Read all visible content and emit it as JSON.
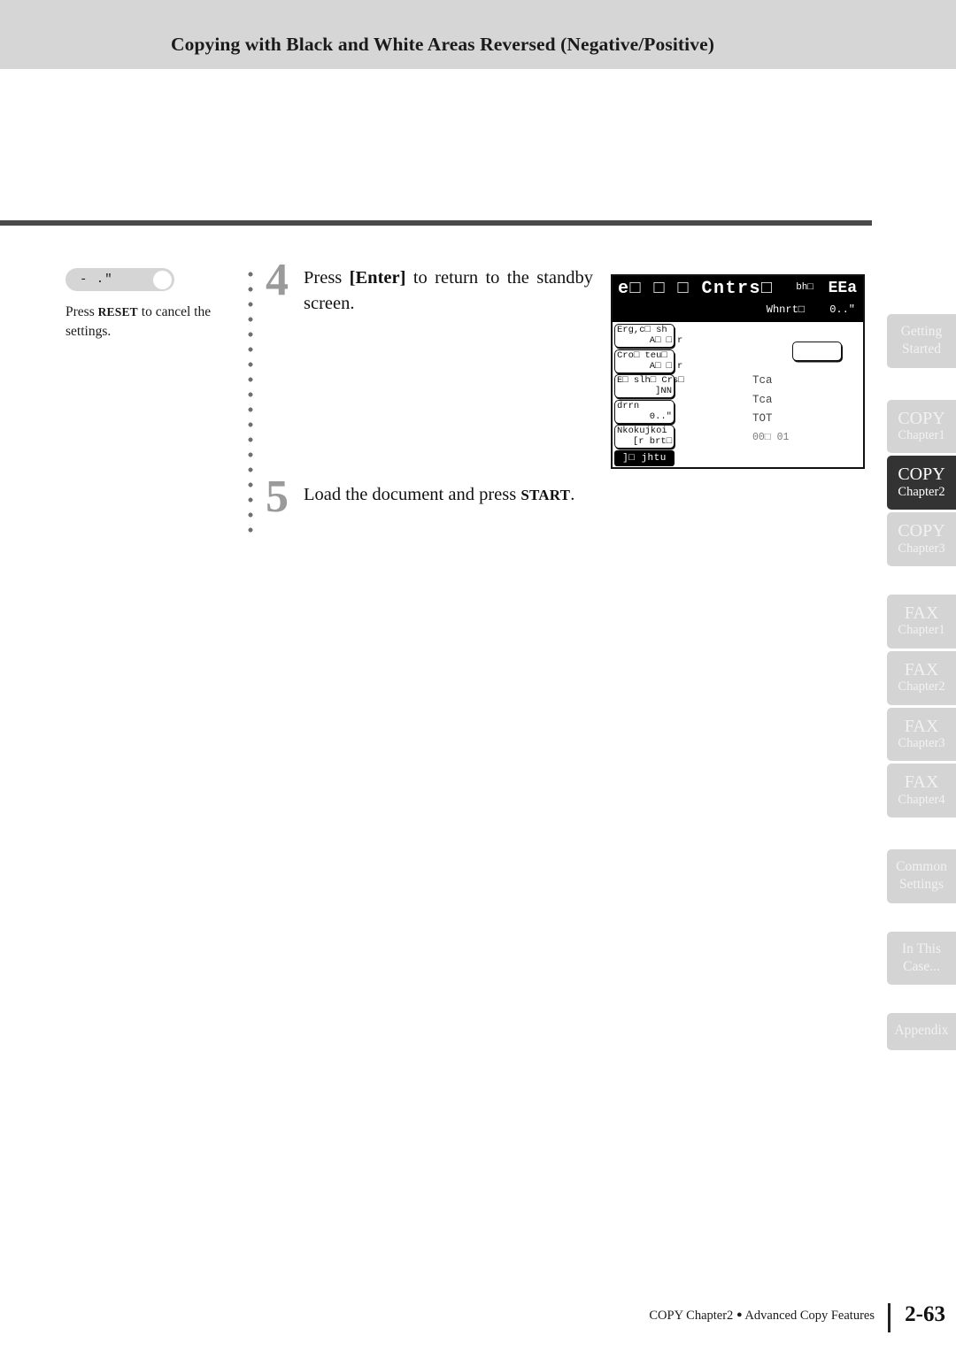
{
  "header": {
    "title": "Copying with Black and White Areas Reversed (Negative/Positive)"
  },
  "sidenote": {
    "pill_label": "- .\"",
    "note_prefix": "Press ",
    "note_key": "RESET",
    "note_suffix": " to cancel the settings."
  },
  "steps": [
    {
      "number": "4",
      "text_before": "Press ",
      "key": "[Enter]",
      "text_after": " to return to the standby screen."
    },
    {
      "number": "5",
      "text_before": "Load the document and press ",
      "key": "START",
      "text_after": "."
    }
  ],
  "lcd": {
    "title": "e□ □ □ Cntrs□",
    "mode": "EEa",
    "mode_sub": "bh□",
    "subrow_left": "Whnrt□",
    "subrow_right": "0..\"",
    "buttons": [
      {
        "line1": "Erg,c□ sh",
        "line2": "A□ □",
        "overflow": "r"
      },
      {
        "line1": "Cro□ teu□",
        "line2": "A□ □",
        "overflow": "r"
      },
      {
        "line1": "E□ slh□ Crs□",
        "line2": "]NN",
        "overflow": ""
      },
      {
        "line1": "drrn",
        "line2": "0..\"",
        "overflow": ""
      },
      {
        "line1": "Nkokujkoi",
        "line2": "[r brt□",
        "overflow": ""
      }
    ],
    "status_bar": "]□ jhtu",
    "right_list": [
      "Tca",
      "Tca",
      "TOT"
    ],
    "right_last": "00□ 01"
  },
  "tabs": [
    {
      "main": "Getting",
      "sub": "Started",
      "style": "small",
      "active": false
    },
    {
      "main": "COPY",
      "sub": "Chapter1",
      "style": "normal",
      "active": false
    },
    {
      "main": "COPY",
      "sub": "Chapter2",
      "style": "normal",
      "active": true
    },
    {
      "main": "COPY",
      "sub": "Chapter3",
      "style": "normal",
      "active": false
    },
    {
      "main": "FAX",
      "sub": "Chapter1",
      "style": "normal",
      "active": false
    },
    {
      "main": "FAX",
      "sub": "Chapter2",
      "style": "normal",
      "active": false
    },
    {
      "main": "FAX",
      "sub": "Chapter3",
      "style": "normal",
      "active": false
    },
    {
      "main": "FAX",
      "sub": "Chapter4",
      "style": "normal",
      "active": false
    },
    {
      "main": "Common",
      "sub": "Settings",
      "style": "small",
      "active": false
    },
    {
      "main": "In This",
      "sub": "Case...",
      "style": "small",
      "active": false
    },
    {
      "main": "Appendix",
      "sub": "",
      "style": "one-line",
      "active": false
    }
  ],
  "footer": {
    "text_left": "COPY Chapter2",
    "bullet": "●",
    "text_right": "Advanced Copy Features",
    "page_number": "2-63"
  }
}
